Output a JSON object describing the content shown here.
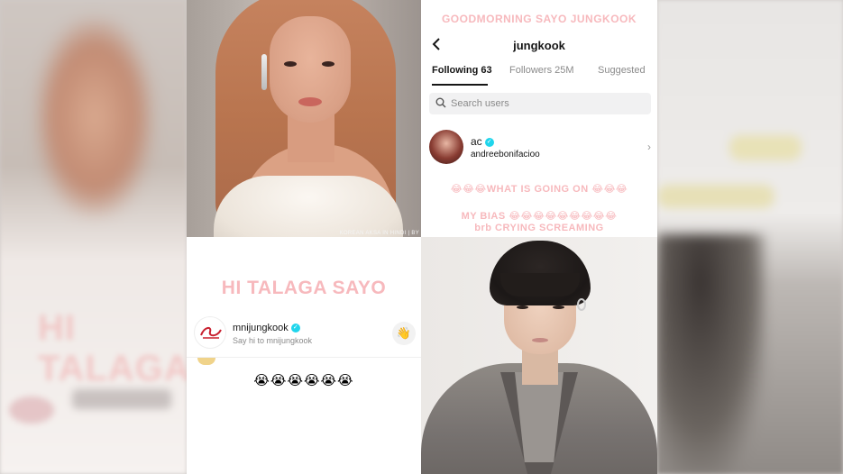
{
  "panels": {
    "photo_top_left": {
      "subject": "woman-portrait",
      "credit": "KOREAN AKSA IN HINDI | BY"
    },
    "chat_top_right": {
      "overlay_top": "GOODMORNING SAYO JUNGKOOK",
      "back_icon": "chevron-left-icon",
      "username": "jungkook",
      "tabs": [
        {
          "label": "Following 63",
          "active": true
        },
        {
          "label": "Followers 25M",
          "active": false
        },
        {
          "label": "Suggested",
          "active": false
        }
      ],
      "search": {
        "icon": "search-icon",
        "placeholder": "Search users"
      },
      "user": {
        "name": "ac",
        "verified": true,
        "handle": "andreebonifacioo",
        "chevron": "chevron-right-icon"
      },
      "overlay_mid": "😂😂😂WHAT IS GOING ON 😂😂😂",
      "overlay_bias": "MY BIAS 😂😂😂😂😂😂😂😂😂",
      "overlay_cry": "brb CRYING SCREAMING"
    },
    "chat_bottom_left": {
      "title": "HI TALAGA SAYO",
      "user": {
        "name": "mnijungkook",
        "verified": true,
        "subtitle": "Say hi to mnijungkook",
        "wave_icon": "waving-hand-icon",
        "wave_emoji": "👋"
      },
      "crying_emojis": "😭😭😭😭😭😭"
    },
    "photo_bottom_right": {
      "subject": "man-portrait"
    }
  },
  "colors": {
    "overlay_pink": "#f7b9bd",
    "verified_blue": "#20d5ec",
    "text_dark": "#161616",
    "text_muted": "#8a8a8a"
  }
}
